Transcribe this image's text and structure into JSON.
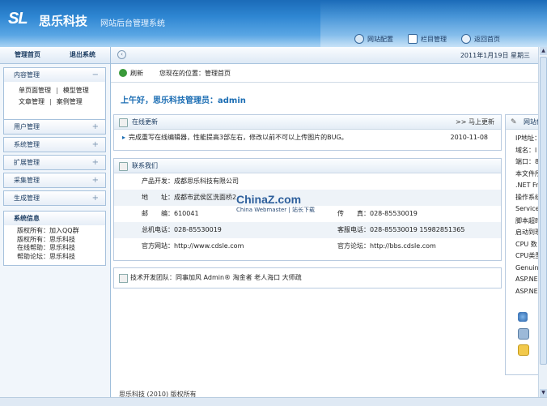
{
  "header": {
    "logo_sl": "SL",
    "logo_cn": "思乐科技",
    "system_title": "网站后台管理系统",
    "nav": [
      {
        "label": "网站配置",
        "icon": "settings-icon"
      },
      {
        "label": "栏目管理",
        "icon": "column-icon"
      },
      {
        "label": "返回首页",
        "icon": "home-icon"
      }
    ]
  },
  "left": {
    "top_links": [
      "管理首页",
      "退出系统"
    ],
    "content_menu": {
      "title": "内容管理",
      "sign": "−",
      "row1": [
        "单页面管理",
        "|",
        "模型管理"
      ],
      "row2": [
        "文章管理",
        "|",
        "案例管理"
      ]
    },
    "menus": [
      {
        "title": "用户管理",
        "sign": "+"
      },
      {
        "title": "系统管理",
        "sign": "+"
      },
      {
        "title": "扩展管理",
        "sign": "+"
      },
      {
        "title": "采集管理",
        "sign": "+"
      },
      {
        "title": "生成管理",
        "sign": "+"
      }
    ],
    "sysinfo": {
      "title": "系统信息",
      "lines": [
        "版权所有：加入QQ群",
        "版权所有：思乐科技",
        "在线帮助：思乐科技",
        "帮助论坛：思乐科技"
      ]
    }
  },
  "main": {
    "date": "2011年1月19日 星期三",
    "refresh": "刷新",
    "location": "您现在的位置：管理首页",
    "greeting": "上午好，思乐科技管理员：admin",
    "update": {
      "title": "在线更新",
      "more": ">> 马上更新",
      "item": "完成重写在线编辑器，性能提高3部左右，修改以前不可以上传图片的BUG。",
      "item_date": "2010-11-08"
    },
    "contact": {
      "title": "联系我们",
      "rows": [
        [
          "产品开发：成都思乐科技有限公司",
          ""
        ],
        [
          "地　　址：成都市武侯区洗面桥2",
          ""
        ],
        [
          "邮　　编：610041",
          "传　　真：028-85530019"
        ],
        [
          "总机电话：028-85530019",
          "客服电话：028-85530019 15982851365"
        ],
        [
          "官方网站：http://www.cdsle.com",
          "官方论坛：http://bbs.cdsle.com"
        ]
      ]
    },
    "team": "技术开发团队：同事加风 Admin® 淘金者 老人海口 大师疏",
    "footer": "思乐科技 (2010) 版权所有"
  },
  "side": {
    "title": "网站信",
    "items": [
      "IP地址：",
      "域名：l",
      "端口：8",
      "本文件所",
      ".NET Fr",
      "操作系统",
      "Service",
      "脚本超时",
      "启动到现",
      "CPU 数",
      "CPU类型",
      "Genuine",
      "ASP.NE",
      "ASP.NE"
    ]
  },
  "watermark": {
    "main": "ChinaZ.com",
    "sub": "China Webmaster | 站长下载"
  },
  "colors": {
    "header": "#2e86d2",
    "accent": "#1b6db3",
    "border": "#b9cbe0"
  }
}
